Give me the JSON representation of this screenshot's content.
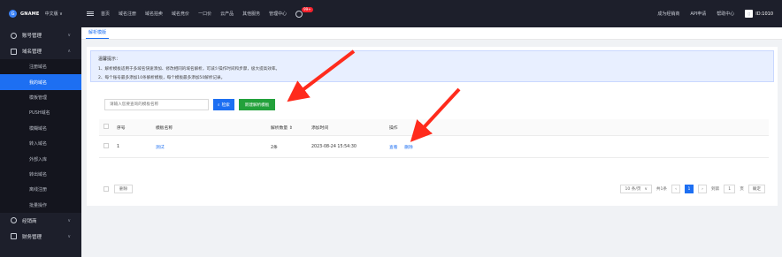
{
  "topbar": {
    "logo_text": "GNAME",
    "language": "中文版 ∨",
    "nav": [
      "首页",
      "域名注册",
      "域名拍卖",
      "域名竞价",
      "一口价",
      "云产品",
      "其他服务",
      "管理中心"
    ],
    "notification_badge": "99+",
    "right_links": [
      "成为经销商",
      "API申请",
      "帮助中心"
    ],
    "avatar_letter": "g",
    "user_id": "ID:1010"
  },
  "sidebar": {
    "groups": [
      {
        "label": "账号管理",
        "chevron": "∨"
      },
      {
        "label": "域名管理",
        "chevron": "∧"
      }
    ],
    "sub_items": [
      "注册域名",
      "我的域名",
      "模板管理",
      "PUSH域名",
      "模糊域名",
      "转入域名",
      "外部入库",
      "转出域名",
      "离线注册",
      "批量操作"
    ],
    "active_index": 1,
    "bottom_groups": [
      {
        "label": "经销商",
        "chevron": "∨"
      },
      {
        "label": "财务管理",
        "chevron": "∨"
      }
    ]
  },
  "tabs": [
    "解析模版"
  ],
  "notice": {
    "title": "温馨提示：",
    "lines": [
      "1、解析模板适用于多域名快速添加、修改相同的域名解析，可减少操作时间和步骤，极大提高效率。",
      "2、每个账号最多添加10条解析模板，每个模板最多添加50解析记录。"
    ]
  },
  "toolbar": {
    "search_placeholder": "请输入您要查询的模板名称",
    "search_label": "检索",
    "add_label": "新建解析模板"
  },
  "table": {
    "headers": [
      "序号",
      "模板名称",
      "解析数量 ⇕",
      "添加时间",
      "操作"
    ],
    "rows": [
      {
        "index": "1",
        "name": "测试",
        "count": "2条",
        "time": "2023-08-24 15:54:30",
        "view": "查看",
        "delete": "删除"
      }
    ]
  },
  "footer": {
    "delete_label": "删除",
    "page_size": "10 条/页",
    "total": "共1条",
    "current_page": "1",
    "goto_label": "到第",
    "goto_value": "1",
    "page_unit": "页",
    "confirm_label": "确定"
  },
  "colors": {
    "primary": "#1d6ff2",
    "add_button": "#23a13b",
    "arrow": "#ff2b1c",
    "topbar": "#1d1f2b"
  }
}
